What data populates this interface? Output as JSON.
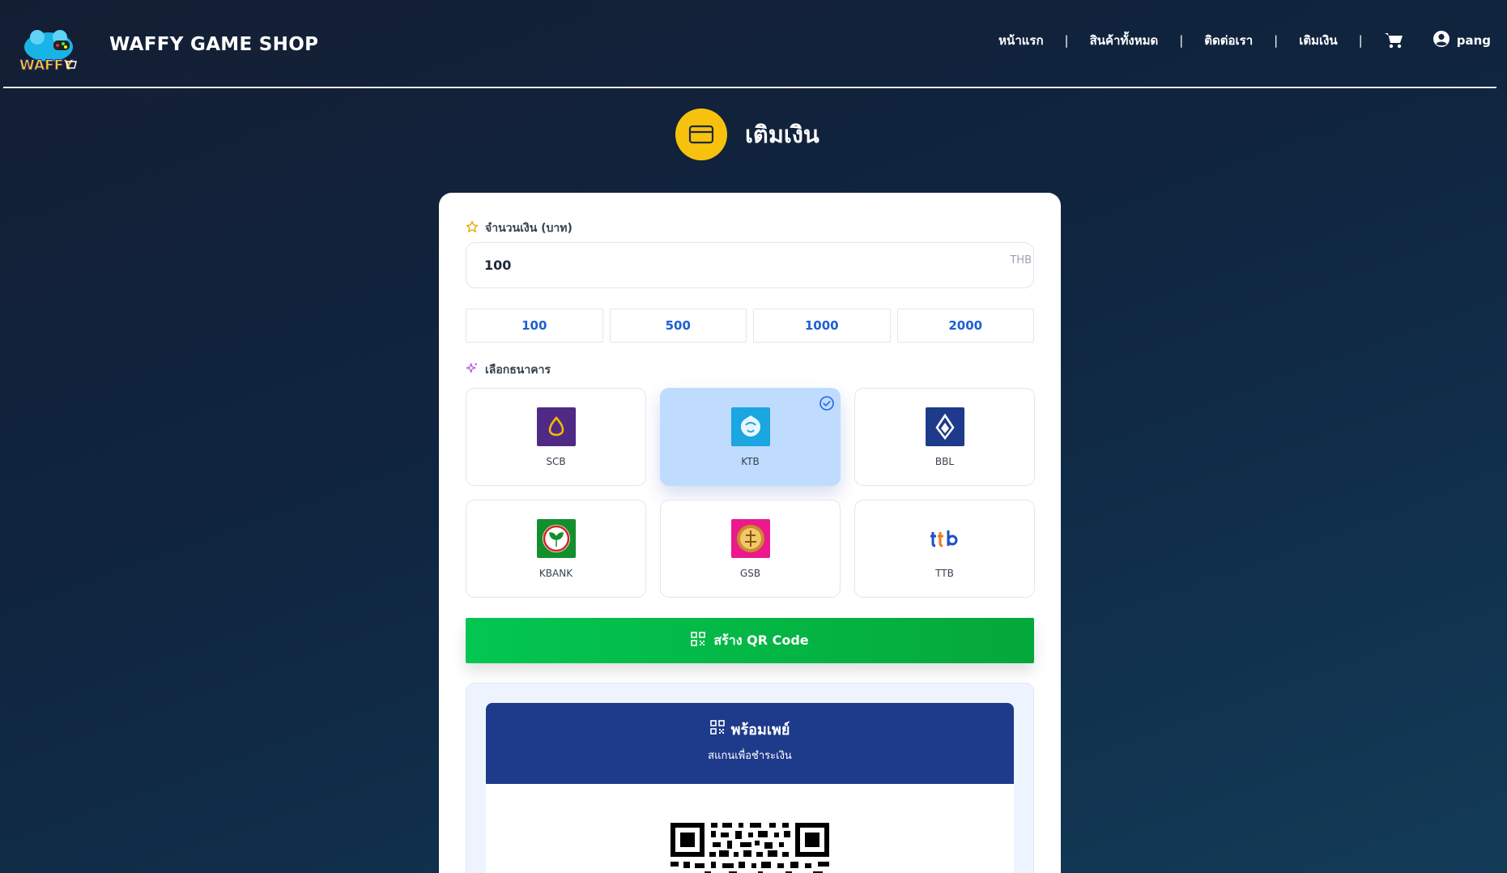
{
  "header": {
    "brand": "WAFFY GAME SHOP",
    "logo_text": "WAFFY",
    "nav": [
      {
        "label": "หน้าแรก"
      },
      {
        "label": "สินค้าทั้งหมด"
      },
      {
        "label": "ติดต่อเรา"
      },
      {
        "label": "เติมเงิน"
      }
    ],
    "separator": "|",
    "cart_icon": "cart-icon",
    "user_icon": "user-circle-icon",
    "username": "pang"
  },
  "page": {
    "title": "เติมเงิน",
    "title_icon": "credit-card-icon"
  },
  "amount": {
    "label": "จำนวนเงิน (บาท)",
    "value": "100",
    "currency": "THB",
    "presets": [
      "100",
      "500",
      "1000",
      "2000"
    ]
  },
  "banks": {
    "label": "เลือกธนาคาร",
    "selected": "KTB",
    "items": [
      {
        "code": "SCB",
        "color": "#4e2a84"
      },
      {
        "code": "KTB",
        "color": "#1ba5e1"
      },
      {
        "code": "BBL",
        "color": "#1e3a8a"
      },
      {
        "code": "KBANK",
        "color": "#138f2d"
      },
      {
        "code": "GSB",
        "color": "#eb198d"
      },
      {
        "code": "TTB",
        "color": "#ffffff"
      }
    ]
  },
  "generate_button": {
    "label": "สร้าง QR Code"
  },
  "promptpay": {
    "title": "พร้อมเพย์",
    "subtitle": "สแกนเพื่อชำระเงิน"
  },
  "colors": {
    "accent_yellow": "#f6c20e",
    "selected_bank_bg": "#bfdbfe",
    "green_button": "#03c652",
    "promptpay_blue": "#1e3a8a",
    "preset_text": "#1d5fd6"
  }
}
